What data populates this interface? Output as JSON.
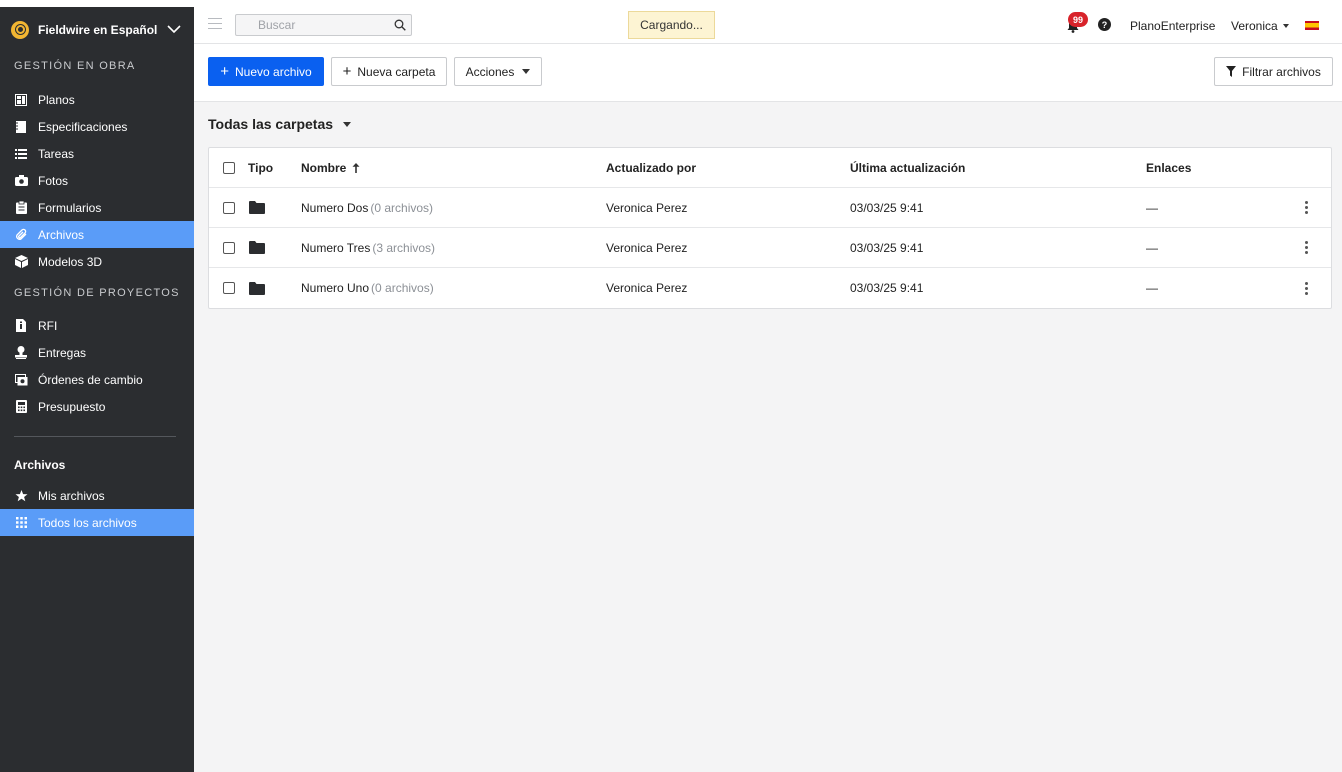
{
  "sidebar": {
    "project_name": "Fieldwire en Español",
    "sections": [
      {
        "title": "GESTIÓN EN OBRA",
        "items": [
          {
            "label": "Planos",
            "icon": "plans-icon",
            "active": false
          },
          {
            "label": "Especificaciones",
            "icon": "specifications-icon",
            "active": false
          },
          {
            "label": "Tareas",
            "icon": "tasks-list-icon",
            "active": false
          },
          {
            "label": "Fotos",
            "icon": "camera-icon",
            "active": false
          },
          {
            "label": "Formularios",
            "icon": "clipboard-icon",
            "active": false
          },
          {
            "label": "Archivos",
            "icon": "paperclip-icon",
            "active": true
          },
          {
            "label": "Modelos 3D",
            "icon": "cube-icon",
            "active": false
          }
        ]
      },
      {
        "title": "GESTIÓN DE PROYECTOS",
        "items": [
          {
            "label": "RFI",
            "icon": "rfi-document-icon",
            "active": false
          },
          {
            "label": "Entregas",
            "icon": "stamp-icon",
            "active": false
          },
          {
            "label": "Órdenes de cambio",
            "icon": "change-order-icon",
            "active": false
          },
          {
            "label": "Presupuesto",
            "icon": "calculator-icon",
            "active": false
          }
        ]
      }
    ],
    "files_group": {
      "title": "Archivos",
      "items": [
        {
          "label": "Mis archivos",
          "icon": "star-icon",
          "active": false
        },
        {
          "label": "Todos los archivos",
          "icon": "grid-icon",
          "active": true
        }
      ]
    }
  },
  "topbar": {
    "search_placeholder": "Buscar",
    "loading_text": "Cargando...",
    "notification_count": "99",
    "help_label": "?",
    "plan_label": "PlanoEnterprise",
    "user_name": "Veronica"
  },
  "toolbar": {
    "new_file_label": "Nuevo archivo",
    "new_folder_label": "Nueva carpeta",
    "actions_label": "Acciones",
    "filter_label": "Filtrar archivos"
  },
  "breadcrumb": {
    "label": "Todas las carpetas"
  },
  "table": {
    "headers": {
      "type": "Tipo",
      "name": "Nombre",
      "updated_by": "Actualizado por",
      "last_update": "Última actualización",
      "links": "Enlaces"
    },
    "rows": [
      {
        "name": "Numero Dos",
        "count": "(0 archivos)",
        "updated_by": "Veronica Perez",
        "last_update": "03/03/25 9:41",
        "links": "—"
      },
      {
        "name": "Numero Tres",
        "count": "(3 archivos)",
        "updated_by": "Veronica Perez",
        "last_update": "03/03/25 9:41",
        "links": "—"
      },
      {
        "name": "Numero Uno",
        "count": "(0 archivos)",
        "updated_by": "Veronica Perez",
        "last_update": "03/03/25 9:41",
        "links": "—"
      }
    ]
  },
  "colors": {
    "sidebar_bg": "#2b2d30",
    "active_item": "#5a9cf8",
    "primary_button": "#0a60f0",
    "badge": "#d8232a",
    "loading_bg": "#fdf4d3"
  }
}
